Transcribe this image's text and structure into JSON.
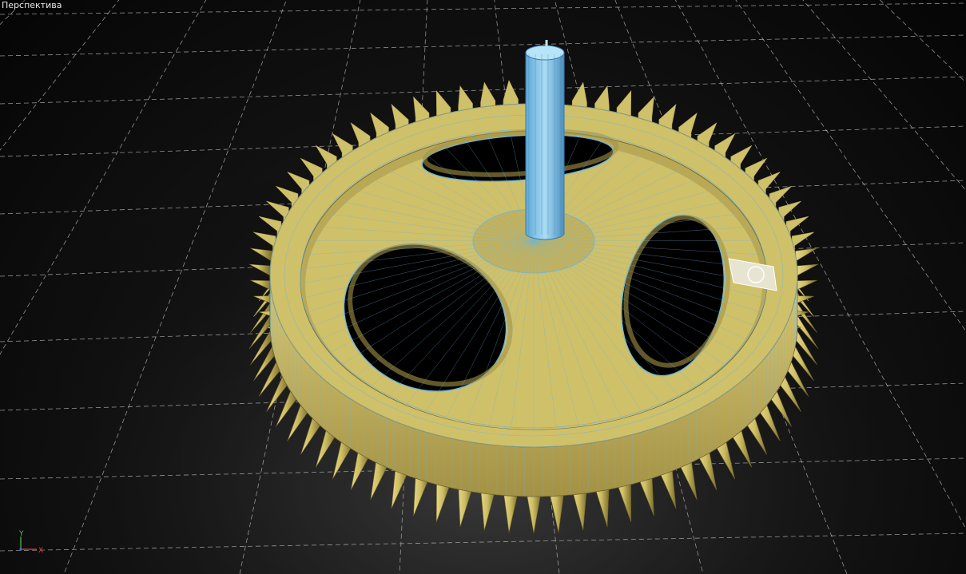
{
  "viewport": {
    "label": "Перспектива",
    "background": "#000000",
    "grid_color": "#bdbdbd"
  },
  "model": {
    "type": "gear-with-shaft",
    "tooth_count": 72,
    "spoke_holes": 3,
    "body_color": "#cfc06a",
    "shadow_color": "#8a7d3a",
    "wire_color": "#6fb6d8",
    "shaft_color": "#8cc8ea",
    "selection_color": "#ffffff"
  },
  "axis_gizmo": {
    "y": "Y",
    "x": "X",
    "y_color": "#46c846",
    "x_color": "#e04040",
    "origin_color": "#4a6adf"
  }
}
